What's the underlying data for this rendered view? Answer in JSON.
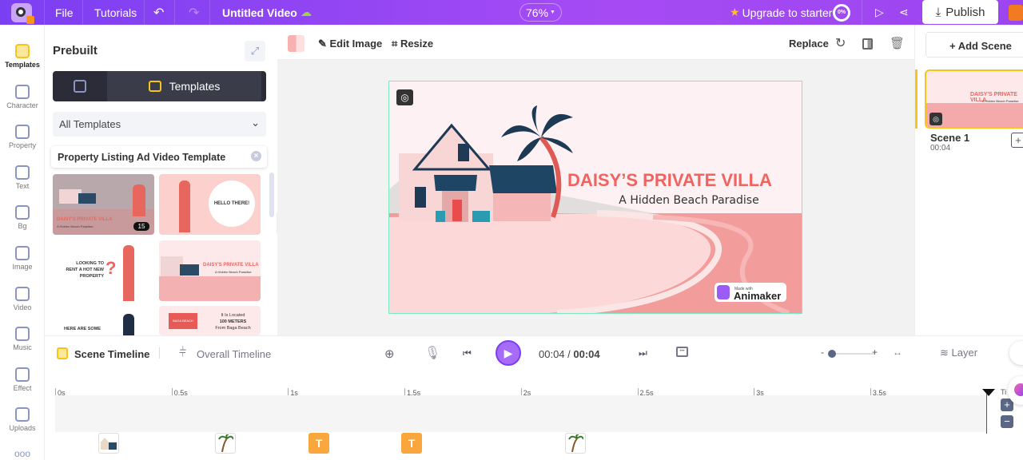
{
  "topbar": {
    "file": "File",
    "tutorials": "Tutorials",
    "title": "Untitled Video",
    "zoom": "76%",
    "upgrade": "Upgrade to starter",
    "progress": "0%",
    "publish": "Publish"
  },
  "leftnav": [
    {
      "label": "Templates",
      "icon": "clapper-icon"
    },
    {
      "label": "Character",
      "icon": "person-icon"
    },
    {
      "label": "Property",
      "icon": "cup-icon"
    },
    {
      "label": "Text",
      "icon": "text-icon"
    },
    {
      "label": "Bg",
      "icon": "layers-icon"
    },
    {
      "label": "Image",
      "icon": "image-icon"
    },
    {
      "label": "Video",
      "icon": "video-icon"
    },
    {
      "label": "Music",
      "icon": "music-icon"
    },
    {
      "label": "Effect",
      "icon": "effect-icon"
    },
    {
      "label": "Uploads",
      "icon": "upload-icon"
    }
  ],
  "panel": {
    "title": "Prebuilt",
    "tab": "Templates",
    "dropdown": "All Templates",
    "search": "Property Listing Ad Video Template",
    "thumbs": {
      "t1_title": "DAISY'S PRIVATE VILLA",
      "t1_sub": "A Hidden Beach Paradise",
      "t1_count": "15",
      "t2": "HELLO THERE!",
      "t3": "LOOKING TO RENT A HOT NEW PROPERTY",
      "t4_title": "DAISY'S PRIVATE VILLA",
      "t4_sub": "A Hidden Beach Paradise",
      "t5": "HERE ARE SOME",
      "t6_sign": "BAGA BEACH",
      "t6_l1": "It Is Located",
      "t6_l2": "100 METERS",
      "t6_l3": "From Baga Beach"
    }
  },
  "edit": {
    "edit_image": "Edit Image",
    "resize": "Resize",
    "replace": "Replace"
  },
  "canvas": {
    "title": "DAISY’S PRIVATE VILLA",
    "subtitle": "A Hidden Beach Paradise",
    "badge_small": "Made with",
    "badge": "Animaker"
  },
  "scenes": {
    "add": "+ Add Scene",
    "items": [
      {
        "name": "Scene 1",
        "duration": "00:04",
        "thumb_title": "DAISY'S PRIVATE VILLA",
        "thumb_sub": "A Hidden Beach Paradise"
      }
    ]
  },
  "timeline": {
    "scene": "Scene Timeline",
    "overall": "Overall Timeline",
    "current": "00:04",
    "total": "00:04",
    "layer": "Layer",
    "ticks": [
      "0s",
      "0.5s",
      "1s",
      "1.5s",
      "2s",
      "2.5s",
      "3s",
      "3.5s"
    ],
    "end_label": "Ti",
    "items": [
      "house",
      "palm",
      "T",
      "T",
      "palm"
    ]
  },
  "colors": {
    "accent": "#8b3ff2",
    "title": "#f0635f",
    "sand": "#fdd6d6",
    "sea": "#f29a9a",
    "selected": "#f5c518"
  }
}
